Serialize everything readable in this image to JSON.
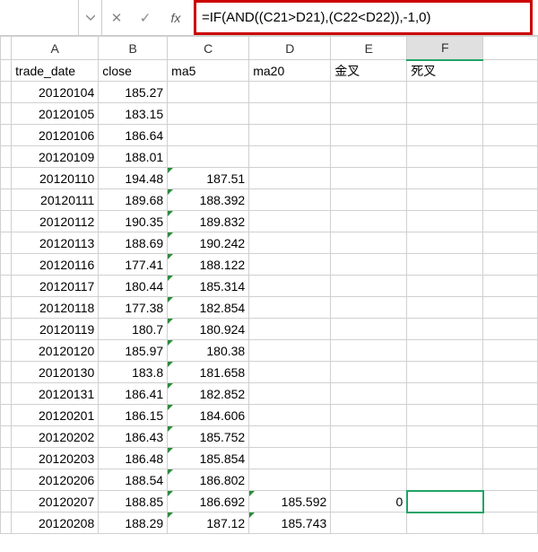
{
  "formulaBar": {
    "nameBox": "",
    "cancelGlyph": "✕",
    "confirmGlyph": "✓",
    "fxLabel": "fx",
    "formula": "=IF(AND((C21>D21),(C22<D22)),-1,0)"
  },
  "columns": [
    "A",
    "B",
    "C",
    "D",
    "E",
    "F"
  ],
  "selectedColumn": "F",
  "headers": {
    "A": "trade_date",
    "B": "close",
    "C": "ma5",
    "D": "ma20",
    "E": "金叉",
    "F": "死叉"
  },
  "rows": [
    {
      "A": "20120104",
      "B": "185.27",
      "C": "",
      "D": "",
      "E": "",
      "F": ""
    },
    {
      "A": "20120105",
      "B": "183.15",
      "C": "",
      "D": "",
      "E": "",
      "F": ""
    },
    {
      "A": "20120106",
      "B": "186.64",
      "C": "",
      "D": "",
      "E": "",
      "F": ""
    },
    {
      "A": "20120109",
      "B": "188.01",
      "C": "",
      "D": "",
      "E": "",
      "F": ""
    },
    {
      "A": "20120110",
      "B": "194.48",
      "C": "187.51",
      "Ctri": true,
      "D": "",
      "E": "",
      "F": ""
    },
    {
      "A": "20120111",
      "B": "189.68",
      "C": "188.392",
      "Ctri": true,
      "D": "",
      "E": "",
      "F": ""
    },
    {
      "A": "20120112",
      "B": "190.35",
      "C": "189.832",
      "Ctri": true,
      "D": "",
      "E": "",
      "F": ""
    },
    {
      "A": "20120113",
      "B": "188.69",
      "C": "190.242",
      "Ctri": true,
      "D": "",
      "E": "",
      "F": ""
    },
    {
      "A": "20120116",
      "B": "177.41",
      "C": "188.122",
      "Ctri": true,
      "D": "",
      "E": "",
      "F": ""
    },
    {
      "A": "20120117",
      "B": "180.44",
      "C": "185.314",
      "Ctri": true,
      "D": "",
      "E": "",
      "F": ""
    },
    {
      "A": "20120118",
      "B": "177.38",
      "C": "182.854",
      "Ctri": true,
      "D": "",
      "E": "",
      "F": ""
    },
    {
      "A": "20120119",
      "B": "180.7",
      "C": "180.924",
      "Ctri": true,
      "D": "",
      "E": "",
      "F": ""
    },
    {
      "A": "20120120",
      "B": "185.97",
      "C": "180.38",
      "Ctri": true,
      "D": "",
      "E": "",
      "F": ""
    },
    {
      "A": "20120130",
      "B": "183.8",
      "C": "181.658",
      "Ctri": true,
      "D": "",
      "E": "",
      "F": ""
    },
    {
      "A": "20120131",
      "B": "186.41",
      "C": "182.852",
      "Ctri": true,
      "D": "",
      "E": "",
      "F": ""
    },
    {
      "A": "20120201",
      "B": "186.15",
      "C": "184.606",
      "Ctri": true,
      "D": "",
      "E": "",
      "F": ""
    },
    {
      "A": "20120202",
      "B": "186.43",
      "C": "185.752",
      "Ctri": true,
      "D": "",
      "E": "",
      "F": ""
    },
    {
      "A": "20120203",
      "B": "186.48",
      "C": "185.854",
      "Ctri": true,
      "D": "",
      "E": "",
      "F": ""
    },
    {
      "A": "20120206",
      "B": "188.54",
      "C": "186.802",
      "Ctri": true,
      "D": "",
      "E": "",
      "F": ""
    },
    {
      "A": "20120207",
      "B": "188.85",
      "C": "186.692",
      "Ctri": true,
      "D": "185.592",
      "Dtri": true,
      "E": "0",
      "F": "",
      "Fsel": true
    },
    {
      "A": "20120208",
      "B": "188.29",
      "C": "187.12",
      "Ctri": true,
      "D": "185.743",
      "Dtri": true,
      "E": "",
      "F": ""
    }
  ]
}
